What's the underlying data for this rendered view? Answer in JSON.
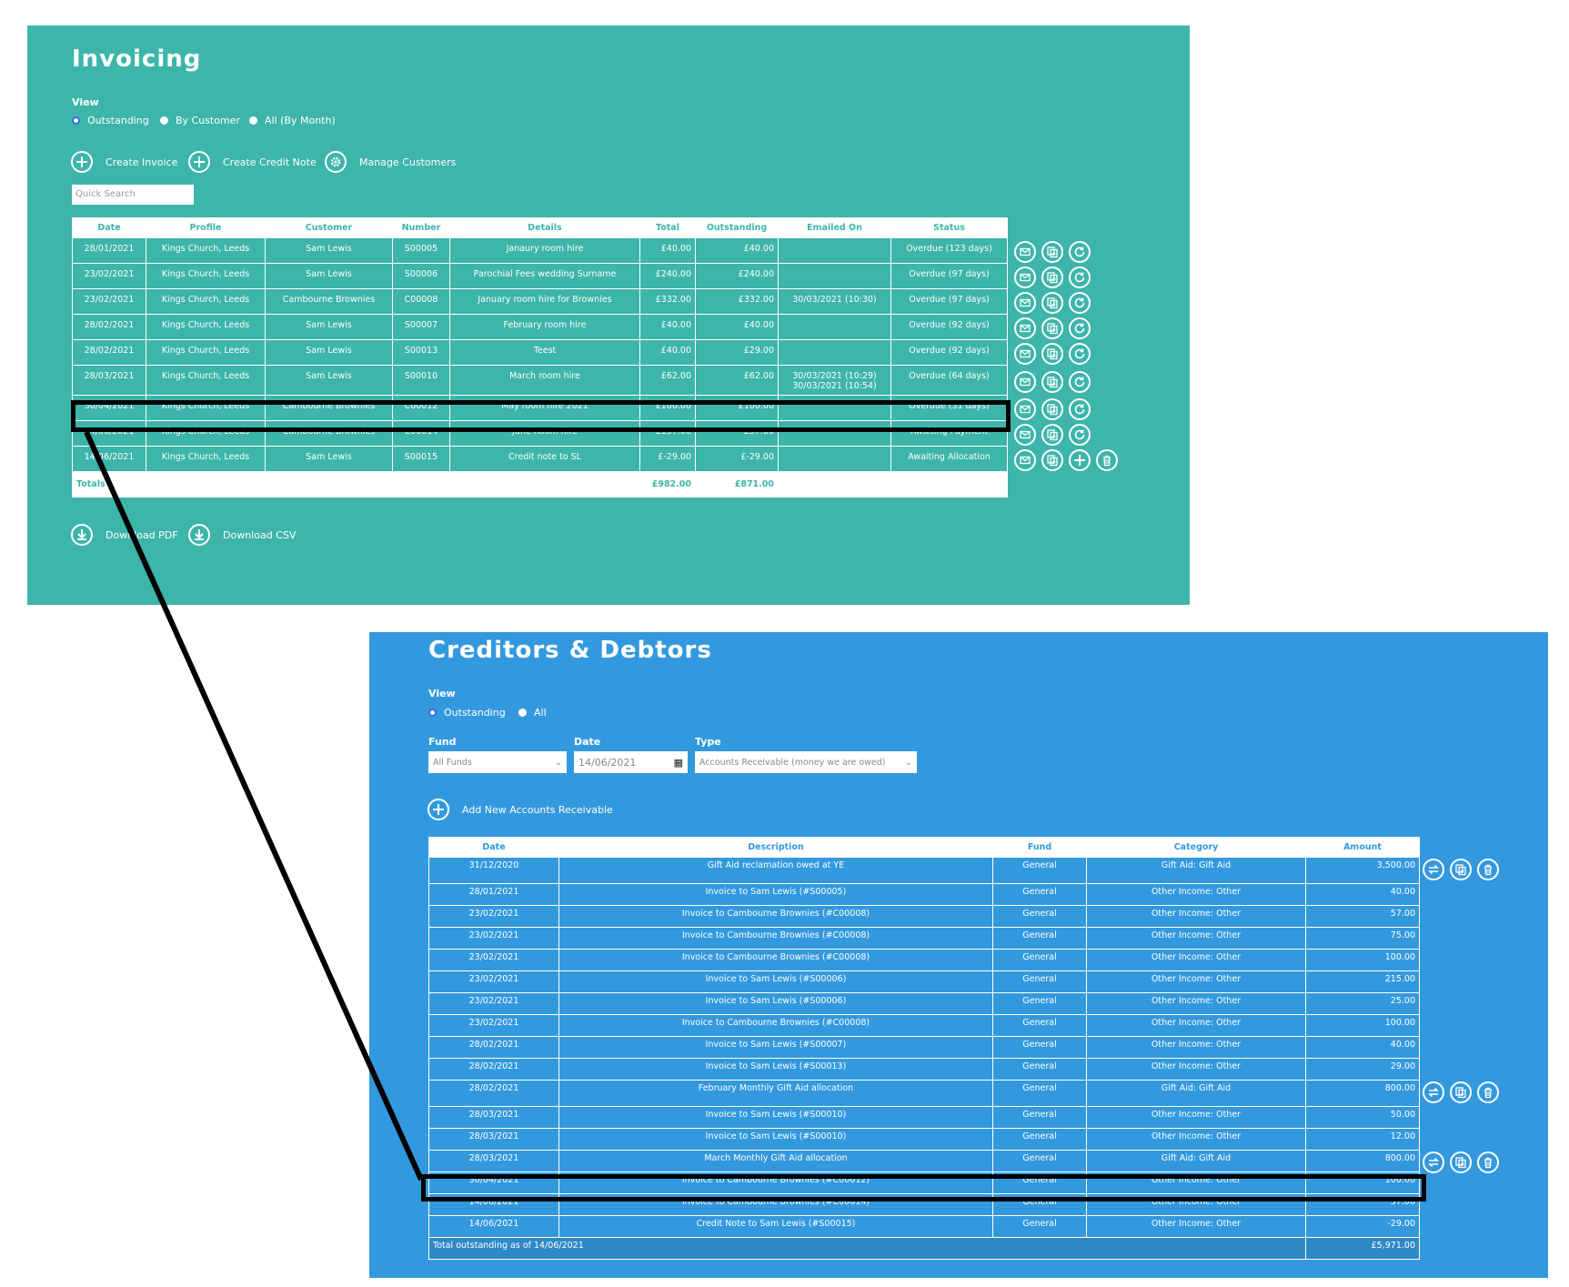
{
  "invoicing": {
    "title": "Invoicing",
    "view_label": "View",
    "view_options": [
      "Outstanding",
      "By Customer",
      "All (By Month)"
    ],
    "actions": [
      "Create Invoice",
      "Create Credit Note",
      "Manage Customers"
    ],
    "search_placeholder": "Quick Search",
    "columns": [
      "Date",
      "Profile",
      "Customer",
      "Number",
      "Details",
      "Total",
      "Outstanding",
      "Emailed On",
      "Status"
    ],
    "rows": [
      [
        "28/01/2021",
        "Kings Church, Leeds",
        "Sam Lewis",
        "S00005",
        "Janaury room hire",
        "£40.00",
        "£40.00",
        "",
        "Overdue (123 days)"
      ],
      [
        "23/02/2021",
        "Kings Church, Leeds",
        "Sam Lewis",
        "S00006",
        "Parochial Fees wedding Surname",
        "£240.00",
        "£240.00",
        "",
        "Overdue (97 days)"
      ],
      [
        "23/02/2021",
        "Kings Church, Leeds",
        "Cambourne Brownies",
        "C00008",
        "January room hire for Brownies",
        "£332.00",
        "£332.00",
        "30/03/2021 (10:30)",
        "Overdue (97 days)"
      ],
      [
        "28/02/2021",
        "Kings Church, Leeds",
        "Sam Lewis",
        "S00007",
        "February room hire",
        "£40.00",
        "£40.00",
        "",
        "Overdue (92 days)"
      ],
      [
        "28/02/2021",
        "Kings Church, Leeds",
        "Sam Lewis",
        "S00013",
        "Teest",
        "£40.00",
        "£29.00",
        "",
        "Overdue (92 days)"
      ],
      [
        "28/03/2021",
        "Kings Church, Leeds",
        "Sam Lewis",
        "S00010",
        "March room hire",
        "£62.00",
        "£62.00",
        "30/03/2021 (10:29)\n30/03/2021 (10:54)",
        "Overdue (64 days)"
      ],
      [
        "30/04/2021",
        "Kings Church, Leeds",
        "Cambourne Brownies",
        "C00012",
        "May room hire 2021",
        "£100.00",
        "£100.00",
        "",
        "Overdue (31 days)"
      ],
      [
        "14/06/2021",
        "Kings Church, Leeds",
        "Cambourne Brownies",
        "C00014",
        "June Room hire",
        "£157.00",
        "£57.00",
        "",
        "Awaiting Payment"
      ],
      [
        "14/06/2021",
        "Kings Church, Leeds",
        "Sam Lewis",
        "S00015",
        "Credit note to SL",
        "£-29.00",
        "£-29.00",
        "",
        "Awaiting Allocation"
      ]
    ],
    "totals_label": "Totals",
    "total": "£982.00",
    "outstanding_total": "£871.00",
    "downloads": [
      "Download PDF",
      "Download CSV"
    ]
  },
  "creditors": {
    "title": "Creditors & Debtors",
    "view_label": "View",
    "view_options": [
      "Outstanding",
      "All"
    ],
    "fund_label": "Fund",
    "fund_value": "All Funds",
    "date_label": "Date",
    "date_value": "14/06/2021",
    "type_label": "Type",
    "type_value": "Accounts Receivable (money we are owed)",
    "add_label": "Add New Accounts Receivable",
    "columns": [
      "Date",
      "Description",
      "Fund",
      "Category",
      "Amount"
    ],
    "rows": [
      [
        "31/12/2020",
        "Gift Aid reclamation owed at YE",
        "General",
        "Gift Aid: Gift Aid",
        "3,500.00"
      ],
      [
        "28/01/2021",
        "Invoice to Sam Lewis (#S00005)",
        "General",
        "Other Income: Other",
        "40.00"
      ],
      [
        "23/02/2021",
        "Invoice to Cambourne Brownies (#C00008)",
        "General",
        "Other Income: Other",
        "57.00"
      ],
      [
        "23/02/2021",
        "Invoice to Cambourne Brownies (#C00008)",
        "General",
        "Other Income: Other",
        "75.00"
      ],
      [
        "23/02/2021",
        "Invoice to Cambourne Brownies (#C00008)",
        "General",
        "Other Income: Other",
        "100.00"
      ],
      [
        "23/02/2021",
        "Invoice to Sam Lewis (#S00006)",
        "General",
        "Other Income: Other",
        "215.00"
      ],
      [
        "23/02/2021",
        "Invoice to Sam Lewis (#S00006)",
        "General",
        "Other Income: Other",
        "25.00"
      ],
      [
        "23/02/2021",
        "Invoice to Cambourne Brownies (#C00008)",
        "General",
        "Other Income: Other",
        "100.00"
      ],
      [
        "28/02/2021",
        "Invoice to Sam Lewis (#S00007)",
        "General",
        "Other Income: Other",
        "40.00"
      ],
      [
        "28/02/2021",
        "Invoice to Sam Lewis (#S00013)",
        "General",
        "Other Income: Other",
        "29.00"
      ],
      [
        "28/02/2021",
        "February Monthly Gift Aid allocation",
        "General",
        "Gift Aid: Gift Aid",
        "800.00"
      ],
      [
        "28/03/2021",
        "Invoice to Sam Lewis (#S00010)",
        "General",
        "Other Income: Other",
        "50.00"
      ],
      [
        "28/03/2021",
        "Invoice to Sam Lewis (#S00010)",
        "General",
        "Other Income: Other",
        "12.00"
      ],
      [
        "28/03/2021",
        "March Monthly Gift Aid allocation",
        "General",
        "Gift Aid: Gift Aid",
        "800.00"
      ],
      [
        "30/04/2021",
        "Invoice to Cambourne Brownies (#C00012)",
        "General",
        "Other Income: Other",
        "100.00"
      ],
      [
        "14/06/2021",
        "Invoice to Cambourne Brownies (#C00014)",
        "General",
        "Other Income: Other",
        "57.00"
      ],
      [
        "14/06/2021",
        "Credit Note to Sam Lewis (#S00015)",
        "General",
        "Other Income: Other",
        "-29.00"
      ]
    ],
    "total_label": "Total outstanding as of 14/06/2021",
    "total_value": "£5,971.00"
  },
  "icons": [
    "plus-icon",
    "gear-icon",
    "email-icon",
    "duplicate-icon",
    "refresh-icon",
    "trash-icon",
    "download-icon",
    "transfer-icon",
    "calendar-icon",
    "chevron-down-icon"
  ]
}
